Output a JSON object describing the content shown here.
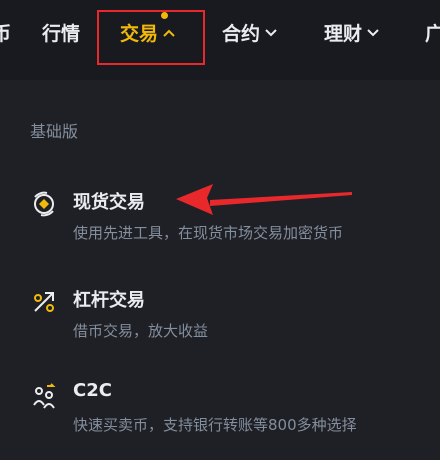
{
  "nav": {
    "items": [
      {
        "label": "币"
      },
      {
        "label": "行情"
      },
      {
        "label": "交易"
      },
      {
        "label": "合约"
      },
      {
        "label": "理财"
      },
      {
        "label": "广"
      }
    ]
  },
  "dropdown": {
    "section_label": "基础版",
    "items": [
      {
        "title": "现货交易",
        "desc": "使用先进工具，在现货市场交易加密货币",
        "icon": "spot-trade-icon"
      },
      {
        "title": "杠杆交易",
        "desc": "借币交易，放大收益",
        "icon": "margin-trade-icon"
      },
      {
        "title": "C2C",
        "desc": "快速买卖币，支持银行转账等800多种选择",
        "icon": "c2c-icon"
      }
    ]
  },
  "colors": {
    "accent": "#f0b90b",
    "background": "#1e2026",
    "nav_background": "#181a20",
    "annotation_red": "#e8282b"
  }
}
